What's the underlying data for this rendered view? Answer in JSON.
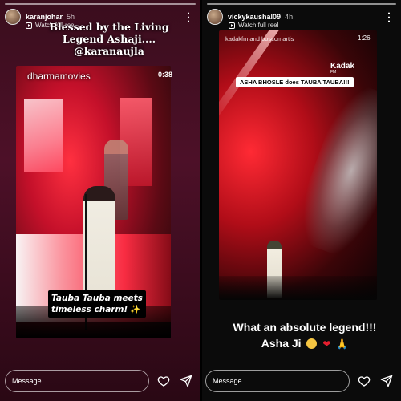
{
  "left_story": {
    "username": "karanjohar",
    "time": "5h",
    "watch_label": "Watch full reel",
    "overlay_line1": "Blessed by the Living",
    "overlay_line2": "Legend Ashaji....",
    "overlay_mention": "@karanaujla",
    "video_brand": "dharmamovies",
    "video_duration": "0:38",
    "caption_line1": "Tauba Tauba meets",
    "caption_line2": "timeless charm!",
    "caption_emoji": "✨",
    "message_placeholder": "Message"
  },
  "right_story": {
    "username": "vickykaushal09",
    "time": "4h",
    "watch_label": "Watch full reel",
    "video_credit": "kadakfm and boscomartis",
    "video_duration": "1:26",
    "video_logo": "Kadak",
    "video_logo_sub": "FM",
    "video_caption": "ASHA BHOSLE does TAUBA TAUBA!!!",
    "text_line1": "What an absolute legend!!!",
    "text_line2": "Asha Ji",
    "message_placeholder": "Message"
  },
  "icons": [
    "more-icon",
    "reel-icon",
    "heart-icon",
    "send-icon"
  ]
}
